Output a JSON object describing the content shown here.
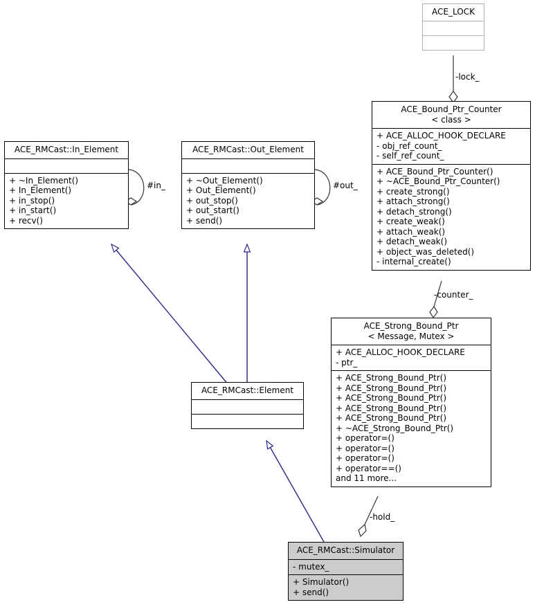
{
  "diagram": {
    "kind": "uml-class-diagram",
    "colors": {
      "background": "#ffffff",
      "box_border": "#000000",
      "external_border": "#b0b0b0",
      "highlight_fill": "#cccccc",
      "inheritance_edge": "#25258c",
      "association_edge": "#000000",
      "text": "#000000"
    }
  },
  "classes": {
    "ace_lock": {
      "name": "ACE_LOCK",
      "template": "",
      "attributes": [],
      "operations": []
    },
    "bound_ptr_counter": {
      "name": "ACE_Bound_Ptr_Counter",
      "template": "< class >",
      "attributes": [
        "+ ACE_ALLOC_HOOK_DECLARE",
        "- obj_ref_count_",
        "- self_ref_count_"
      ],
      "operations": [
        "+ ACE_Bound_Ptr_Counter()",
        "+ ~ACE_Bound_Ptr_Counter()",
        "+ create_strong()",
        "+ attach_strong()",
        "+ detach_strong()",
        "+ create_weak()",
        "+ attach_weak()",
        "+ detach_weak()",
        "+ object_was_deleted()",
        "- internal_create()"
      ]
    },
    "strong_bound_ptr": {
      "name": "ACE_Strong_Bound_Ptr",
      "template": "< Message, Mutex >",
      "attributes": [
        "+ ACE_ALLOC_HOOK_DECLARE",
        "- ptr_"
      ],
      "operations": [
        "+ ACE_Strong_Bound_Ptr()",
        "+ ACE_Strong_Bound_Ptr()",
        "+ ACE_Strong_Bound_Ptr()",
        "+ ACE_Strong_Bound_Ptr()",
        "+ ACE_Strong_Bound_Ptr()",
        "+ ~ACE_Strong_Bound_Ptr()",
        "+ operator=()",
        "+ operator=()",
        "+ operator=()",
        "+ operator==()",
        "and 11 more..."
      ]
    },
    "in_element": {
      "name": "ACE_RMCast::In_Element",
      "template": "",
      "attributes": [],
      "operations": [
        "+ ~In_Element()",
        "+ In_Element()",
        "+ in_stop()",
        "+ in_start()",
        "+ recv()"
      ]
    },
    "out_element": {
      "name": "ACE_RMCast::Out_Element",
      "template": "",
      "attributes": [],
      "operations": [
        "+ ~Out_Element()",
        "+ Out_Element()",
        "+ out_stop()",
        "+ out_start()",
        "+ send()"
      ]
    },
    "element": {
      "name": "ACE_RMCast::Element",
      "template": "",
      "attributes": [],
      "operations": []
    },
    "simulator": {
      "name": "ACE_RMCast::Simulator",
      "template": "",
      "attributes": [
        "- mutex_"
      ],
      "operations": [
        "+ Simulator()",
        "+ send()"
      ]
    }
  },
  "edge_labels": {
    "lock": "-lock_",
    "counter": "-counter_",
    "hold": "-hold_",
    "in": "#in_",
    "out": "#out_"
  },
  "relationships": [
    {
      "from": "ace_lock",
      "to": "bound_ptr_counter",
      "type": "aggregation",
      "label": "-lock_"
    },
    {
      "from": "bound_ptr_counter",
      "to": "strong_bound_ptr",
      "type": "aggregation",
      "label": "-counter_"
    },
    {
      "from": "strong_bound_ptr",
      "to": "simulator",
      "type": "aggregation",
      "label": "-hold_"
    },
    {
      "from": "in_element",
      "to": "in_element",
      "type": "aggregation",
      "label": "#in_"
    },
    {
      "from": "out_element",
      "to": "out_element",
      "type": "aggregation",
      "label": "#out_"
    },
    {
      "from": "element",
      "to": "in_element",
      "type": "inheritance",
      "label": ""
    },
    {
      "from": "element",
      "to": "out_element",
      "type": "inheritance",
      "label": ""
    },
    {
      "from": "simulator",
      "to": "element",
      "type": "inheritance",
      "label": ""
    }
  ]
}
